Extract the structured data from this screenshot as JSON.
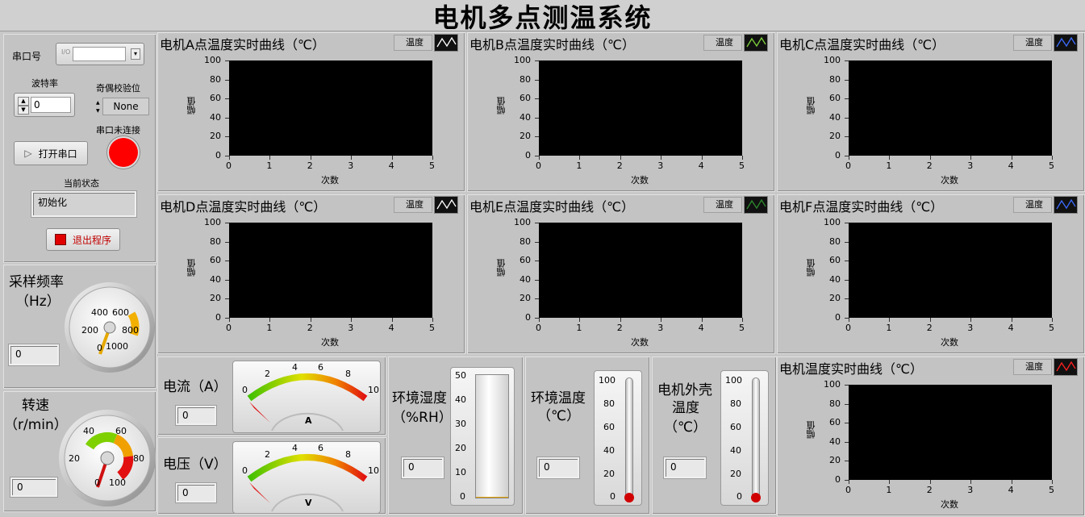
{
  "app": {
    "title": "电机多点测温系统"
  },
  "serial": {
    "port_label": "串口号",
    "port_value": "",
    "port_icon": "I/O",
    "baud_label": "波特率",
    "baud_value": "0",
    "parity_label": "奇偶校验位",
    "parity_value": "None",
    "conn_status_label": "串口未连接",
    "conn_led_color": "#ff0000",
    "open_label": "打开串口",
    "state_label": "当前状态",
    "state_value": "初始化",
    "exit_label": "退出程序"
  },
  "sampling": {
    "label": "采样频率",
    "unit": "（Hz）",
    "value": "0",
    "ticks": [
      "0",
      "200",
      "400",
      "600",
      "800",
      "1000"
    ],
    "needle_value": 0
  },
  "speed": {
    "label": "转速",
    "unit": "（r/min）",
    "value": "0",
    "ticks": [
      "0",
      "20",
      "40",
      "60",
      "80",
      "100"
    ],
    "needle_value": 0
  },
  "charts": [
    {
      "title": "电机A点温度实时曲线（℃）",
      "legend": "温度",
      "color": "#ffffff",
      "xlabel": "次数",
      "ylabel": "幅值",
      "yticks": [
        "100",
        "80",
        "60",
        "40",
        "20",
        "0"
      ],
      "xticks": [
        "0",
        "1",
        "2",
        "3",
        "4",
        "5"
      ],
      "ylim": [
        0,
        100
      ],
      "xlim": [
        0,
        5
      ],
      "values": []
    },
    {
      "title": "电机B点温度实时曲线（℃）",
      "legend": "温度",
      "color": "#7fd23c",
      "xlabel": "次数",
      "ylabel": "幅值",
      "yticks": [
        "100",
        "80",
        "60",
        "40",
        "20",
        "0"
      ],
      "xticks": [
        "0",
        "1",
        "2",
        "3",
        "4",
        "5"
      ],
      "ylim": [
        0,
        100
      ],
      "xlim": [
        0,
        5
      ],
      "values": []
    },
    {
      "title": "电机C点温度实时曲线（℃）",
      "legend": "温度",
      "color": "#3c6cff",
      "xlabel": "次数",
      "ylabel": "幅值",
      "yticks": [
        "100",
        "80",
        "60",
        "40",
        "20",
        "0"
      ],
      "xticks": [
        "0",
        "1",
        "2",
        "3",
        "4",
        "5"
      ],
      "ylim": [
        0,
        100
      ],
      "xlim": [
        0,
        5
      ],
      "values": []
    },
    {
      "title": "电机D点温度实时曲线（℃）",
      "legend": "温度",
      "color": "#ffffff",
      "xlabel": "次数",
      "ylabel": "幅值",
      "yticks": [
        "100",
        "80",
        "60",
        "40",
        "20",
        "0"
      ],
      "xticks": [
        "0",
        "1",
        "2",
        "3",
        "4",
        "5"
      ],
      "ylim": [
        0,
        100
      ],
      "xlim": [
        0,
        5
      ],
      "values": []
    },
    {
      "title": "电机E点温度实时曲线（℃）",
      "legend": "温度",
      "color": "#2e8b2e",
      "xlabel": "次数",
      "ylabel": "幅值",
      "yticks": [
        "100",
        "80",
        "60",
        "40",
        "20",
        "0"
      ],
      "xticks": [
        "0",
        "1",
        "2",
        "3",
        "4",
        "5"
      ],
      "ylim": [
        0,
        100
      ],
      "xlim": [
        0,
        5
      ],
      "values": []
    },
    {
      "title": "电机F点温度实时曲线（℃）",
      "legend": "温度",
      "color": "#3c6cff",
      "xlabel": "次数",
      "ylabel": "幅值",
      "yticks": [
        "100",
        "80",
        "60",
        "40",
        "20",
        "0"
      ],
      "xticks": [
        "0",
        "1",
        "2",
        "3",
        "4",
        "5"
      ],
      "ylim": [
        0,
        100
      ],
      "xlim": [
        0,
        5
      ],
      "values": []
    },
    {
      "title": "电机温度实时曲线（℃）",
      "legend": "温度",
      "color": "#ff2020",
      "xlabel": "次数",
      "ylabel": "幅值",
      "yticks": [
        "100",
        "80",
        "60",
        "40",
        "20",
        "0"
      ],
      "xticks": [
        "0",
        "1",
        "2",
        "3",
        "4",
        "5"
      ],
      "ylim": [
        0,
        100
      ],
      "xlim": [
        0,
        5
      ],
      "values": []
    }
  ],
  "current": {
    "label": "电流（A）",
    "value": "0",
    "unit_mark": "A",
    "ticks": [
      "0",
      "2",
      "4",
      "6",
      "8",
      "10"
    ],
    "needle_value": 0
  },
  "voltage": {
    "label": "电压（V）",
    "value": "0",
    "unit_mark": "V",
    "ticks": [
      "0",
      "2",
      "4",
      "6",
      "8",
      "10"
    ],
    "needle_value": 0
  },
  "humidity": {
    "label": "环境湿度",
    "unit": "（%RH）",
    "value": "0",
    "ticks": [
      "50",
      "40",
      "30",
      "20",
      "10",
      "0"
    ],
    "level": 0
  },
  "env_temp": {
    "label": "环境温度",
    "unit": "（℃）",
    "value": "0",
    "ticks": [
      "100",
      "80",
      "60",
      "40",
      "20",
      "0"
    ],
    "level": 0
  },
  "shell_temp": {
    "label": "电机外壳",
    "label2": "温度",
    "unit": "（℃）",
    "value": "0",
    "ticks": [
      "100",
      "80",
      "60",
      "40",
      "20",
      "0"
    ],
    "level": 0
  }
}
